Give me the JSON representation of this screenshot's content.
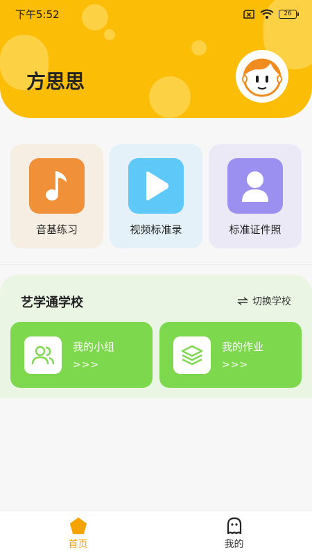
{
  "status_bar": {
    "time": "下午5:52",
    "battery": "26"
  },
  "header": {
    "username": "方思思"
  },
  "features": [
    {
      "label": "音基练习",
      "icon": "music-note-icon",
      "card_color": "#f6ede3",
      "icon_color": "#f0913a"
    },
    {
      "label": "视频标准录",
      "icon": "play-icon",
      "card_color": "#e4f1f8",
      "icon_color": "#5ec8f8"
    },
    {
      "label": "标准证件照",
      "icon": "person-icon",
      "card_color": "#ece9f7",
      "icon_color": "#9b8ff0"
    }
  ],
  "school": {
    "name": "艺学通学校",
    "switch_label": "切换学校",
    "cards": [
      {
        "title": "我的小组",
        "arrow": ">>>",
        "icon": "group-icon"
      },
      {
        "title": "我的作业",
        "arrow": ">>>",
        "icon": "layers-icon"
      }
    ]
  },
  "bottom_nav": [
    {
      "label": "首页",
      "icon": "home-icon",
      "active": true
    },
    {
      "label": "我的",
      "icon": "profile-icon",
      "active": false
    }
  ],
  "colors": {
    "brand": "#fbbd06",
    "green": "#7ed84e",
    "active_nav": "#f4a300"
  }
}
